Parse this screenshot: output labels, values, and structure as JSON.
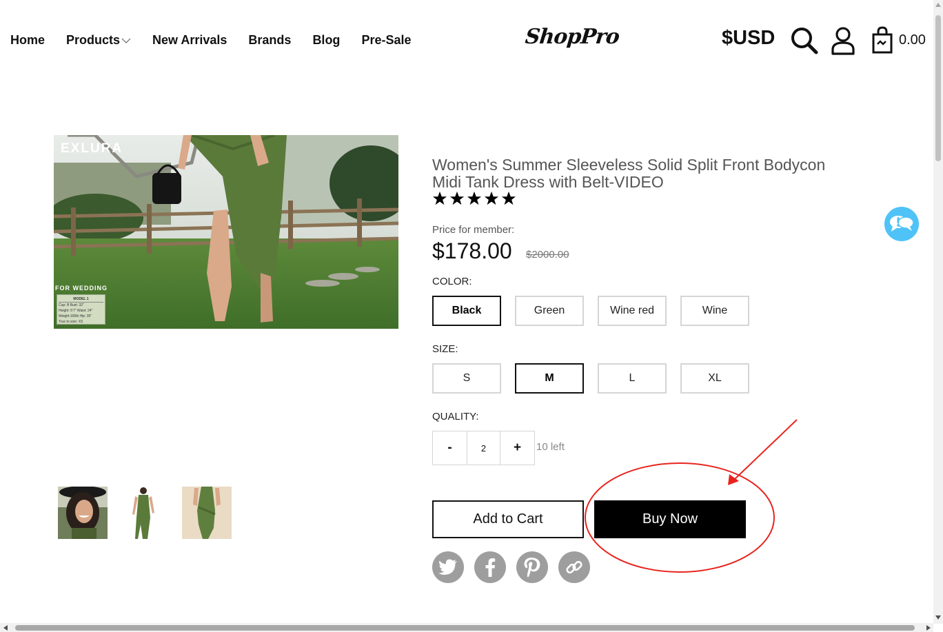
{
  "header": {
    "nav": [
      {
        "label": "Home"
      },
      {
        "label": "Products"
      },
      {
        "label": "New Arrivals"
      },
      {
        "label": "Brands"
      },
      {
        "label": "Blog"
      },
      {
        "label": "Pre-Sale"
      }
    ],
    "logo": "ShopPro",
    "currency": "$USD",
    "cart_total": "0.00"
  },
  "gallery": {
    "brand_text": "EXLURA",
    "caption": "FOR WEDDING",
    "size_card": {
      "title": "MODEL 1",
      "rows": [
        "Cup: B      Bust: 32\"",
        "Height: 5'7\"  Waist: 24\"",
        "Weight:165lb  Hip: 35\"",
        "True to size: XS"
      ]
    }
  },
  "product": {
    "title": "Women's Summer Sleeveless Solid Split Front Bodycon Midi Tank Dress with Belt-VIDEO",
    "rating_stars": 5,
    "price_label": "Price for member:",
    "price": "$178.00",
    "price_old": "$2000.00",
    "color_label": "COLOR:",
    "colors": [
      "Black",
      "Green",
      "Wine red",
      "Wine"
    ],
    "selected_color": "Black",
    "size_label": "SIZE:",
    "sizes": [
      "S",
      "M",
      "L",
      "XL"
    ],
    "selected_size": "M",
    "quantity_label": "QUALITY:",
    "qty_minus": "-",
    "qty_value": "2",
    "qty_plus": "+",
    "stock_text": "10 left",
    "add_to_cart": "Add to Cart",
    "buy_now": "Buy Now"
  },
  "share_icons": [
    "twitter-icon",
    "facebook-icon",
    "pinterest-icon",
    "link-icon"
  ],
  "colors": {
    "annotation": "#e8231d",
    "chat": "#4fc3f7",
    "share_bg": "#9e9e9e"
  }
}
